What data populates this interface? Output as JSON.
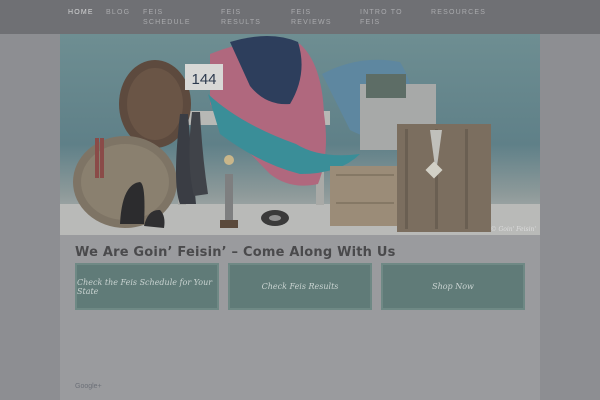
{
  "nav": {
    "items": [
      {
        "label": "HOME"
      },
      {
        "label": "BLOG"
      },
      {
        "label": "FEIS SCHEDULE"
      },
      {
        "label": "FEIS RESULTS"
      },
      {
        "label": "FEIS REVIEWS"
      },
      {
        "label": "INTRO TO FEIS"
      },
      {
        "label": "RESOURCES"
      }
    ]
  },
  "hero": {
    "number_card": "144",
    "credit": "© Goin' Feisin'"
  },
  "main": {
    "heading": "We Are Goin’ Feisin’ – Come Along With Us",
    "buttons": [
      {
        "label": "Check the Feis Schedule for Your State"
      },
      {
        "label": "Check Feis Results"
      },
      {
        "label": "Shop Now"
      }
    ]
  },
  "footer": {
    "link": "Google+"
  }
}
